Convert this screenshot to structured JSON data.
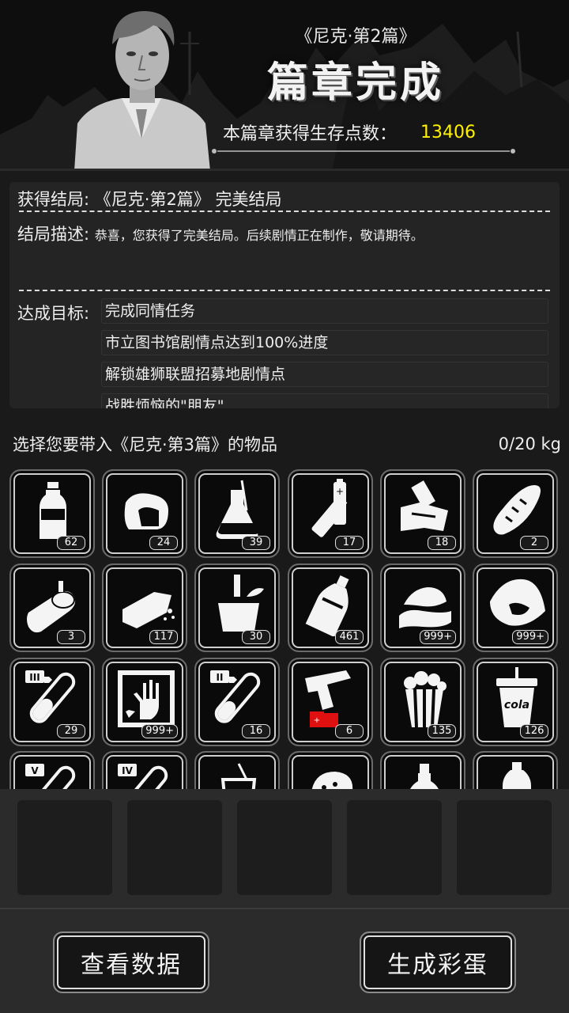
{
  "header": {
    "subtitle": "《尼克·第2篇》",
    "title": "篇章完成",
    "points_label": "本篇章获得生存点数：",
    "points_value": "13406"
  },
  "info": {
    "ending_label": "获得结局:",
    "ending_value": "《尼克·第2篇》 完美结局",
    "desc_label": "结局描述:",
    "desc_value": "恭喜，您获得了完美结局。后续剧情正在制作，敬请期待。",
    "goals_label": "达成目标:",
    "goals": [
      "完成同情任务",
      "市立图书馆剧情点达到100%进度",
      "解锁雄狮联盟招募地剧情点",
      "战胜烦恼的\"朋友\""
    ]
  },
  "inventory": {
    "prompt": "选择您要带入《尼克·第3篇》的物品",
    "weight": "0/20 kg",
    "items": [
      {
        "icon": "water-bottle-icon",
        "count": "62"
      },
      {
        "icon": "meat-chunk-icon",
        "count": "24"
      },
      {
        "icon": "flask-icon",
        "count": "39"
      },
      {
        "icon": "battery-icon",
        "count": "17"
      },
      {
        "icon": "bandage-kit-icon",
        "count": "18"
      },
      {
        "icon": "bread-icon",
        "count": "2"
      },
      {
        "icon": "canned-food-icon",
        "count": "3"
      },
      {
        "icon": "crumb-block-icon",
        "count": "117"
      },
      {
        "icon": "bucket-icon",
        "count": "30"
      },
      {
        "icon": "glass-bottle-icon",
        "count": "461"
      },
      {
        "icon": "cloth-pile-icon",
        "count": "999+"
      },
      {
        "icon": "meat-pie-icon",
        "count": "999+"
      },
      {
        "icon": "test-tube-iii-icon",
        "count": "29"
      },
      {
        "icon": "xray-hand-icon",
        "count": "999+"
      },
      {
        "icon": "test-tube-ii-icon",
        "count": "16"
      },
      {
        "icon": "flare-gun-icon",
        "count": "6"
      },
      {
        "icon": "popcorn-icon",
        "count": "135"
      },
      {
        "icon": "cola-cup-icon",
        "count": "126",
        "label": "cola"
      },
      {
        "icon": "test-tube-v-icon",
        "count": ""
      },
      {
        "icon": "test-tube-iv-icon",
        "count": ""
      },
      {
        "icon": "juice-glass-icon",
        "count": ""
      },
      {
        "icon": "ham-icon",
        "count": ""
      },
      {
        "icon": "vase-icon",
        "count": ""
      },
      {
        "icon": "medicine-bottle-icon",
        "count": ""
      }
    ]
  },
  "buttons": {
    "view_data": "查看数据",
    "generate_egg": "生成彩蛋"
  },
  "colors": {
    "points": "#fff200",
    "flare_red": "#e01010"
  }
}
